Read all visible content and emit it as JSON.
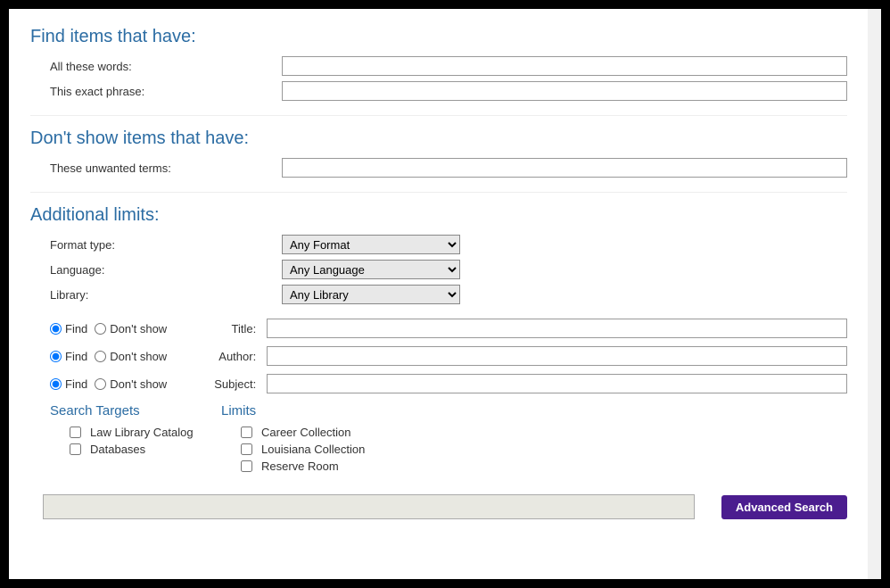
{
  "sections": {
    "find": "Find items that have:",
    "dontShow": "Don't show items that have:",
    "limits": "Additional limits:"
  },
  "findFields": {
    "allWords": "All these words:",
    "exactPhrase": "This exact phrase:"
  },
  "dontShowFields": {
    "unwanted": "These unwanted terms:"
  },
  "selects": {
    "formatLabel": "Format type:",
    "formatValue": "Any Format",
    "languageLabel": "Language:",
    "languageValue": "Any Language",
    "libraryLabel": "Library:",
    "libraryValue": "Any Library"
  },
  "radio": {
    "findLabel": "Find",
    "dontShowLabel": "Don't show",
    "rows": [
      {
        "label": "Title:"
      },
      {
        "label": "Author:"
      },
      {
        "label": "Subject:"
      }
    ]
  },
  "targets": {
    "heading": "Search Targets",
    "items": [
      "Law Library Catalog",
      "Databases"
    ]
  },
  "limitsCol": {
    "heading": "Limits",
    "items": [
      "Career Collection",
      "Louisiana Collection",
      "Reserve Room"
    ]
  },
  "footer": {
    "advancedSearch": "Advanced Search"
  }
}
